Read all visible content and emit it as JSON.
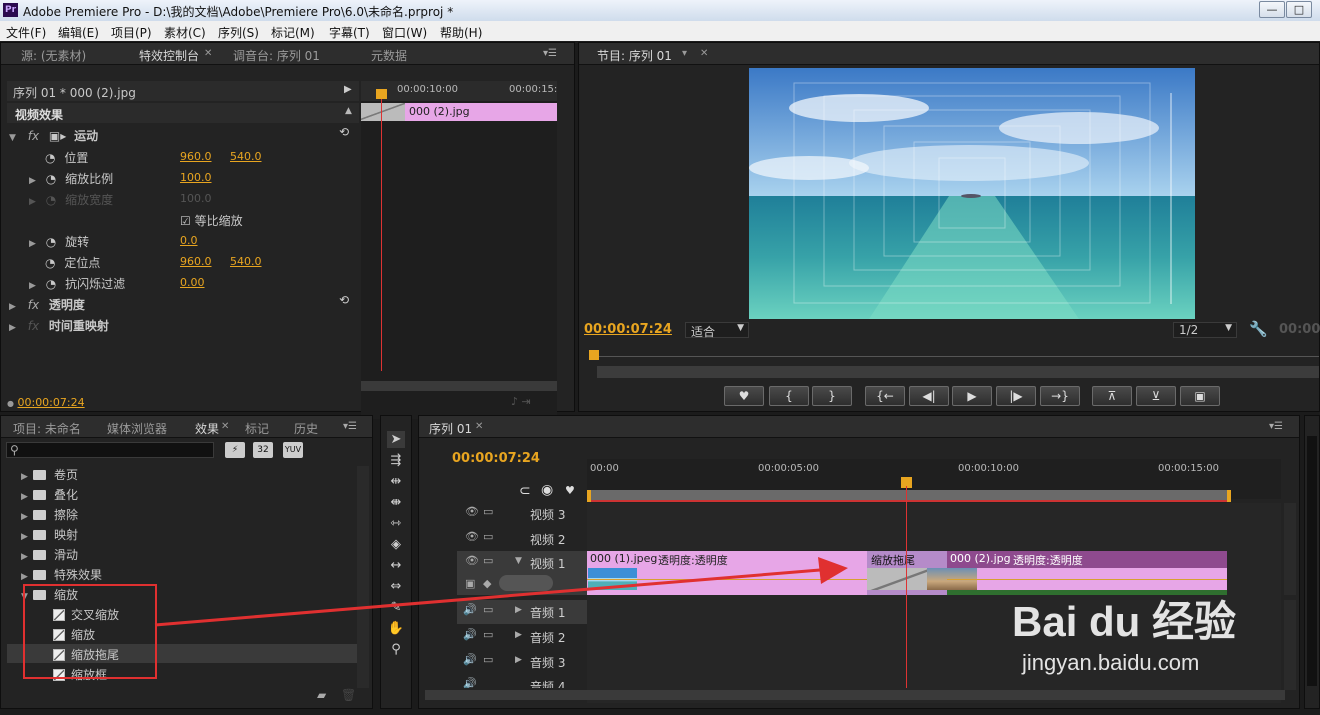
{
  "window": {
    "title": "Adobe Premiere Pro - D:\\我的文档\\Adobe\\Premiere Pro\\6.0\\未命名.prproj *",
    "app_icon": "Pr",
    "buttons": [
      "—",
      "□",
      "✕"
    ]
  },
  "menu": [
    "文件(F)",
    "编辑(E)",
    "项目(P)",
    "素材(C)",
    "序列(S)",
    "标记(M)",
    "字幕(T)",
    "窗口(W)",
    "帮助(H)"
  ],
  "source_panel": {
    "tabs": [
      "源: (无素材)",
      "特效控制台",
      "调音台: 序列 01",
      "元数据"
    ],
    "clip_header": "序列 01 * 000 (2).jpg",
    "timecodes": [
      "00:00:10:00",
      "00:00:15:"
    ],
    "clip_label": "000 (2).jpg",
    "section_title": "视频效果",
    "motion": "运动",
    "params": {
      "position": {
        "label": "位置",
        "x": "960.0",
        "y": "540.0"
      },
      "scale": {
        "label": "缩放比例",
        "value": "100.0"
      },
      "scale_width": {
        "label": "缩放宽度",
        "value": "100.0"
      },
      "uniform": "等比缩放",
      "rotation": {
        "label": "旋转",
        "value": "0.0"
      },
      "anchor": {
        "label": "定位点",
        "x": "960.0",
        "y": "540.0"
      },
      "anti_flicker": {
        "label": "抗闪烁过滤",
        "value": "0.00"
      }
    },
    "opacity": "透明度",
    "time_remap": "时间重映射",
    "fx_badge": "fx",
    "timecode": "00:00:07:24"
  },
  "program_panel": {
    "tab": "节目: 序列 01",
    "timecode": "00:00:07:24",
    "fit": "适合",
    "ratio": "1/2",
    "right_timecode": "00:00"
  },
  "effects_panel": {
    "tabs": [
      "项目: 未命名",
      "媒体浏览器",
      "效果",
      "标记",
      "历史"
    ],
    "badges": [
      "32",
      "YUV"
    ],
    "folders": [
      "卷页",
      "叠化",
      "擦除",
      "映射",
      "滑动",
      "特殊效果",
      "缩放"
    ],
    "presets": [
      "交叉缩放",
      "缩放",
      "缩放拖尾",
      "缩放框"
    ]
  },
  "timeline": {
    "tab": "序列 01",
    "timecode": "00:00:07:24",
    "ruler": [
      "00:00",
      "00:00:05:00",
      "00:00:10:00",
      "00:00:15:00"
    ],
    "video_tracks": [
      "视频 3",
      "视频 2",
      "视频 1"
    ],
    "audio_tracks": [
      "音频 1",
      "音频 2",
      "音频 3",
      "音频 4"
    ],
    "clip1": {
      "name": "000 (1).jpeg",
      "fx": "透明度:透明度"
    },
    "transition": "缩放拖尾",
    "clip2": {
      "name": "000 (2).jpg",
      "fx": "透明度:透明度"
    }
  },
  "watermark": {
    "logo": "Bai du 经验",
    "url": "jingyan.baidu.com"
  },
  "colors": {
    "accent": "#e8a520",
    "clip": "#e7a6e7",
    "playhead": "#d33",
    "annotation": "#e03030"
  }
}
